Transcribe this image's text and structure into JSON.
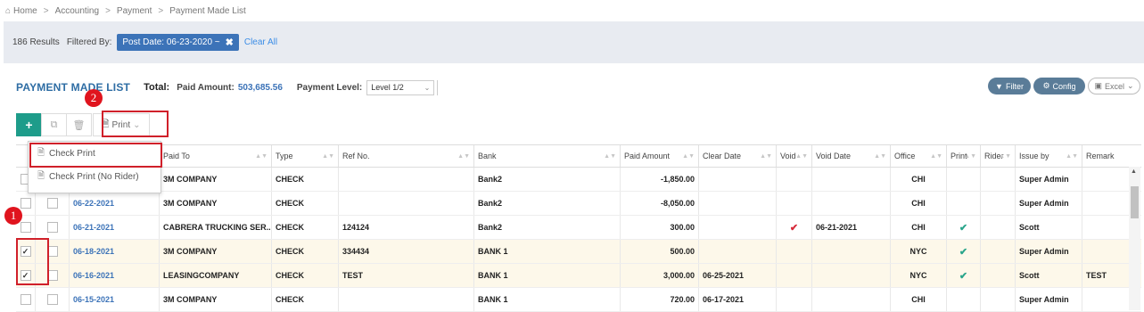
{
  "breadcrumb": {
    "items": [
      "Home",
      "Accounting",
      "Payment",
      "Payment Made List"
    ],
    "separator": ">"
  },
  "filters": {
    "results": "186 Results",
    "filtered_by_label": "Filtered By:",
    "chip_label": "Post Date: 06-23-2020 ~",
    "chip_close": "✖",
    "clear_all": "Clear All"
  },
  "title_bar": {
    "title": "PAYMENT MADE LIST",
    "total_label": "Total:",
    "paid_amount_label": "Paid Amount:",
    "paid_amount_value": "503,685.56",
    "payment_level_label": "Payment Level:",
    "payment_level_value": "Level 1/2"
  },
  "header_buttons": {
    "filter": "Filter",
    "config": "Config",
    "excel": "Excel"
  },
  "toolbar": {
    "add": "+",
    "print_label": "Print"
  },
  "print_menu": {
    "items": [
      "Check Print",
      "Check Print (No Rider)"
    ]
  },
  "annotations": {
    "badge_1": "1",
    "badge_2": "2"
  },
  "columns": [
    "Paid To",
    "Type",
    "Ref No.",
    "Bank",
    "Paid Amount",
    "Clear Date",
    "Void",
    "Void Date",
    "Office",
    "Print",
    "Rider",
    "Issue by",
    "Remark"
  ],
  "rows": [
    {
      "checked": false,
      "date": "",
      "paid_to": "3M COMPANY",
      "type": "CHECK",
      "ref_no": "",
      "bank": "Bank2",
      "paid_amount": "-1,850.00",
      "clear_date": "",
      "void": false,
      "void_date": "",
      "office": "CHI",
      "print": false,
      "rider": false,
      "issue_by": "Super Admin",
      "remark": "",
      "selected": false
    },
    {
      "checked": false,
      "date": "06-22-2021",
      "paid_to": "3M COMPANY",
      "type": "CHECK",
      "ref_no": "",
      "bank": "Bank2",
      "paid_amount": "-8,050.00",
      "clear_date": "",
      "void": false,
      "void_date": "",
      "office": "CHI",
      "print": false,
      "rider": false,
      "issue_by": "Super Admin",
      "remark": "",
      "selected": false
    },
    {
      "checked": false,
      "date": "06-21-2021",
      "paid_to": "CABRERA TRUCKING SER...",
      "type": "CHECK",
      "ref_no": "124124",
      "bank": "Bank2",
      "paid_amount": "300.00",
      "clear_date": "",
      "void": true,
      "void_date": "06-21-2021",
      "office": "CHI",
      "print": true,
      "rider": false,
      "issue_by": "Scott",
      "remark": "",
      "selected": false
    },
    {
      "checked": true,
      "date": "06-18-2021",
      "paid_to": "3M COMPANY",
      "type": "CHECK",
      "ref_no": "334434",
      "bank": "BANK 1",
      "paid_amount": "500.00",
      "clear_date": "",
      "void": false,
      "void_date": "",
      "office": "NYC",
      "print": true,
      "rider": false,
      "issue_by": "Super Admin",
      "remark": "",
      "selected": true
    },
    {
      "checked": true,
      "date": "06-16-2021",
      "paid_to": "LEASINGCOMPANY",
      "type": "CHECK",
      "ref_no": "TEST",
      "bank": "BANK 1",
      "paid_amount": "3,000.00",
      "clear_date": "06-25-2021",
      "void": false,
      "void_date": "",
      "office": "NYC",
      "print": true,
      "rider": false,
      "issue_by": "Scott",
      "remark": "TEST",
      "selected": true
    },
    {
      "checked": false,
      "date": "06-15-2021",
      "paid_to": "3M COMPANY",
      "type": "CHECK",
      "ref_no": "",
      "bank": "BANK 1",
      "paid_amount": "720.00",
      "clear_date": "06-17-2021",
      "void": false,
      "void_date": "",
      "office": "CHI",
      "print": false,
      "rider": false,
      "issue_by": "Super Admin",
      "remark": "",
      "selected": false
    }
  ],
  "colors": {
    "accent": "#3c73b8",
    "add_button": "#1e9c8a",
    "highlight": "#d0202a",
    "check_green": "#2aa58b",
    "check_red": "#d62a3a",
    "selected_row": "#fdf8ea"
  }
}
